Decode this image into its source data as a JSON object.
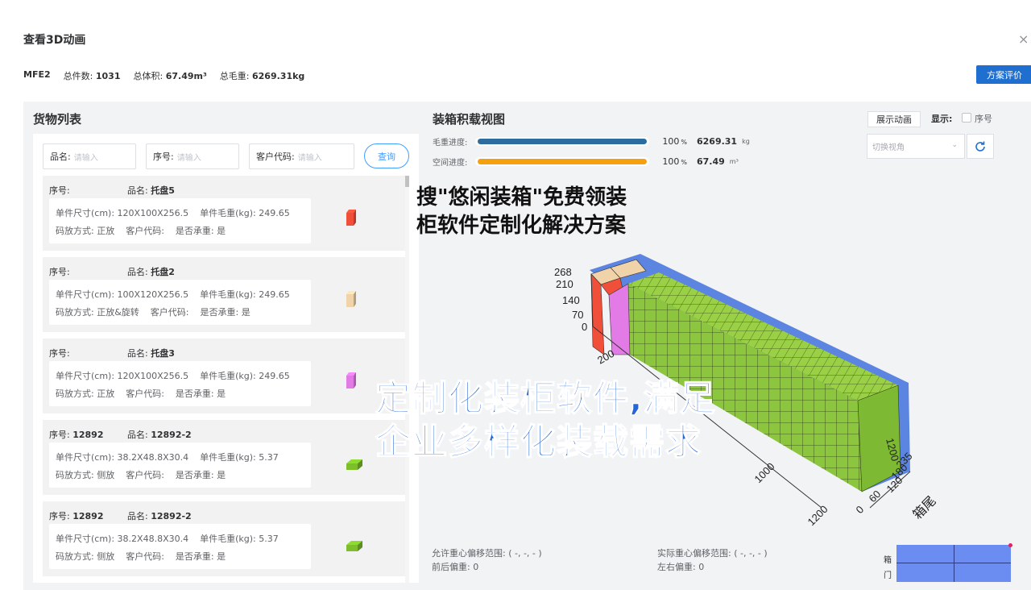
{
  "dialog": {
    "title": "查看3D动画",
    "close_icon": "×"
  },
  "summary": {
    "code": "MFE2",
    "count_label": "总件数:",
    "count": "1031",
    "volume_label": "总体积:",
    "volume": "67.49m³",
    "weight_label": "总毛重:",
    "weight": "6269.31kg",
    "eval_button": "方案评价"
  },
  "cargo_list": {
    "title": "货物列表",
    "search": {
      "name_label": "品名:",
      "name_placeholder": "请输入",
      "seq_label": "序号:",
      "seq_placeholder": "请输入",
      "customer_label": "客户代码:",
      "customer_placeholder": "请输入",
      "query_button": "查询"
    },
    "items": [
      {
        "seq_label": "序号:",
        "seq": "",
        "name_label": "品名:",
        "name": "托盘5",
        "size": "单件尺寸(cm): 120X100X256.5",
        "weight": "单件毛重(kg): 249.65",
        "method": "码放方式: 正放",
        "customer": "客户代码:",
        "bearing": "是否承重: 是",
        "color": "#f0503a"
      },
      {
        "seq_label": "序号:",
        "seq": "",
        "name_label": "品名:",
        "name": "托盘2",
        "size": "单件尺寸(cm): 100X120X256.5",
        "weight": "单件毛重(kg): 249.65",
        "method": "码放方式: 正放&旋转",
        "customer": "客户代码:",
        "bearing": "是否承重: 是",
        "color": "#f0d3a8"
      },
      {
        "seq_label": "序号:",
        "seq": "",
        "name_label": "品名:",
        "name": "托盘3",
        "size": "单件尺寸(cm): 120X100X256.5",
        "weight": "单件毛重(kg): 249.65",
        "method": "码放方式: 正放",
        "customer": "客户代码:",
        "bearing": "是否承重: 是",
        "color": "#e27be6"
      },
      {
        "seq_label": "序号:",
        "seq": "12892",
        "name_label": "品名:",
        "name": "12892-2",
        "size": "单件尺寸(cm): 38.2X48.8X30.4",
        "weight": "单件毛重(kg): 5.37",
        "method": "码放方式: 侧放",
        "customer": "客户代码:",
        "bearing": "是否承重: 是",
        "color": "#7cbf2a"
      },
      {
        "seq_label": "序号:",
        "seq": "12892",
        "name_label": "品名:",
        "name": "12892-2",
        "size": "单件尺寸(cm): 38.2X48.8X30.4",
        "weight": "单件毛重(kg): 5.37",
        "method": "码放方式: 侧放",
        "customer": "客户代码:",
        "bearing": "是否承重: 是",
        "color": "#7cbf2a"
      }
    ]
  },
  "loading_view": {
    "title": "装箱积载视图",
    "weight_progress": {
      "label": "毛重进度:",
      "percent": 100,
      "pct_text": "100",
      "pct_unit": "%",
      "value": "6269.31",
      "unit": "kg",
      "color": "#2f6c9e"
    },
    "space_progress": {
      "label": "空间进度:",
      "percent": 100,
      "pct_text": "100",
      "pct_unit": "%",
      "value": "67.49",
      "unit": "m³",
      "color": "#f5a10f"
    },
    "anim_button": "展示动画",
    "show_label": "显示:",
    "seq_checkbox_label": "序号",
    "view_select_placeholder": "切换视角",
    "axis_labels": {
      "height_ticks": [
        "268",
        "210",
        "140",
        "70",
        "0"
      ],
      "depth_ticks": [
        "200",
        "1200"
      ],
      "length_ticks": [
        "1000",
        "1200"
      ],
      "width_ticks": [
        "235",
        "180",
        "120",
        "60",
        "0"
      ],
      "tail_label": "箱尾"
    }
  },
  "overlay": {
    "line1": "搜\"悠闲装箱\"免费领装",
    "line2": "柜软件定制化解决方案",
    "line3": "定制化装柜软件,满足",
    "line4": "企业多样化装载需求"
  },
  "center_of_gravity": {
    "allowed_range": "允许重心偏移范围: ( -,   -,   - )",
    "actual_range": "实际重心偏移范围: ( -,   -,   - )",
    "front_back": "前后偏重:  0",
    "left_right": "左右偏重:  0"
  },
  "mini_map": {
    "label_top": "箱",
    "label_bottom": "门"
  }
}
